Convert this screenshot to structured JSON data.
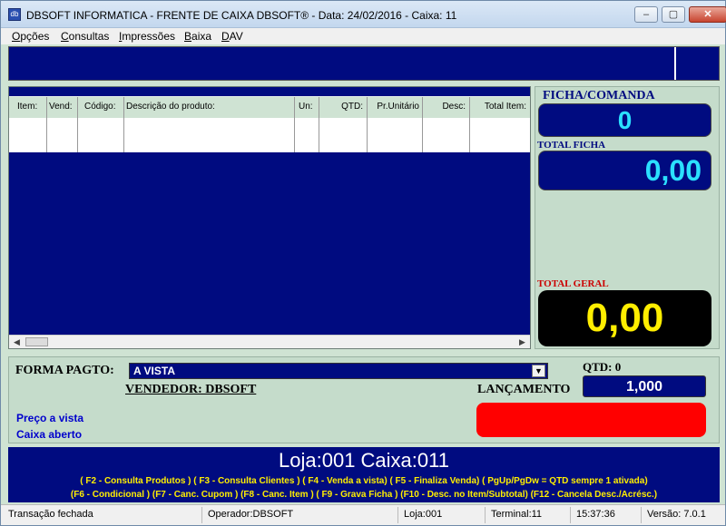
{
  "window": {
    "title": "DBSOFT INFORMATICA - FRENTE DE CAIXA DBSOFT® - Data: 24/02/2016 - Caixa: 11",
    "minimize": "–",
    "maximize": "▢",
    "close": "✕"
  },
  "menu": {
    "items": [
      {
        "accel": "O",
        "rest": "pções"
      },
      {
        "accel": "C",
        "rest": "onsultas"
      },
      {
        "accel": "I",
        "rest": "mpressões"
      },
      {
        "accel": "B",
        "rest": "aixa"
      },
      {
        "accel": "D",
        "rest": "AV"
      }
    ]
  },
  "grid": {
    "columns": [
      "Item:",
      "Vend:",
      "Código:",
      "Descrição do produto:",
      "Un:",
      "QTD:",
      "Pr.Unitário",
      "Desc:",
      "Total Item:"
    ]
  },
  "side": {
    "ficha_label": "FICHA/COMANDA",
    "ficha_value": "0",
    "total_ficha_label": "TOTAL FICHA",
    "total_ficha_value": "0,00",
    "total_geral_label": "TOTAL GERAL",
    "total_geral_value": "0,00"
  },
  "payment": {
    "label": "FORMA PAGTO:",
    "selected": "A VISTA",
    "vendedor": "VENDEDOR: DBSOFT",
    "qtd_label": "QTD: 0",
    "qtd_value": "1,000",
    "lancamento_label": "LANÇAMENTO",
    "preco_text": "Preço a vista",
    "caixa_text": "Caixa aberto"
  },
  "info_bar": "Loja:001  Caixa:011",
  "shortcuts": [
    "( F2 - Consulta Produtos ) ( F3 - Consulta Clientes ) ( F4 - Venda a vista) ( F5 - Finaliza Venda) ( PgUp/PgDw = QTD sempre 1 ativada)",
    "(F6 - Condicional ) (F7 - Canc. Cupom )  (F8 - Canc. Item )  ( F9 - Grava Ficha )  (F10 - Desc. no Item/Subtotal)  (F12 - Cancela Desc./Acrésc.)"
  ],
  "statusbar": [
    "Transação fechada",
    "Operador:DBSOFT",
    "Loja:001",
    "Terminal:11",
    "15:37:36",
    "Versão: 7.0.1"
  ],
  "colors": {
    "navy": "#000b80",
    "cyan_value": "#2be0ff",
    "yellow_value": "#ffee00",
    "red_box": "#ff0000",
    "panel_green": "#c5dccb"
  }
}
